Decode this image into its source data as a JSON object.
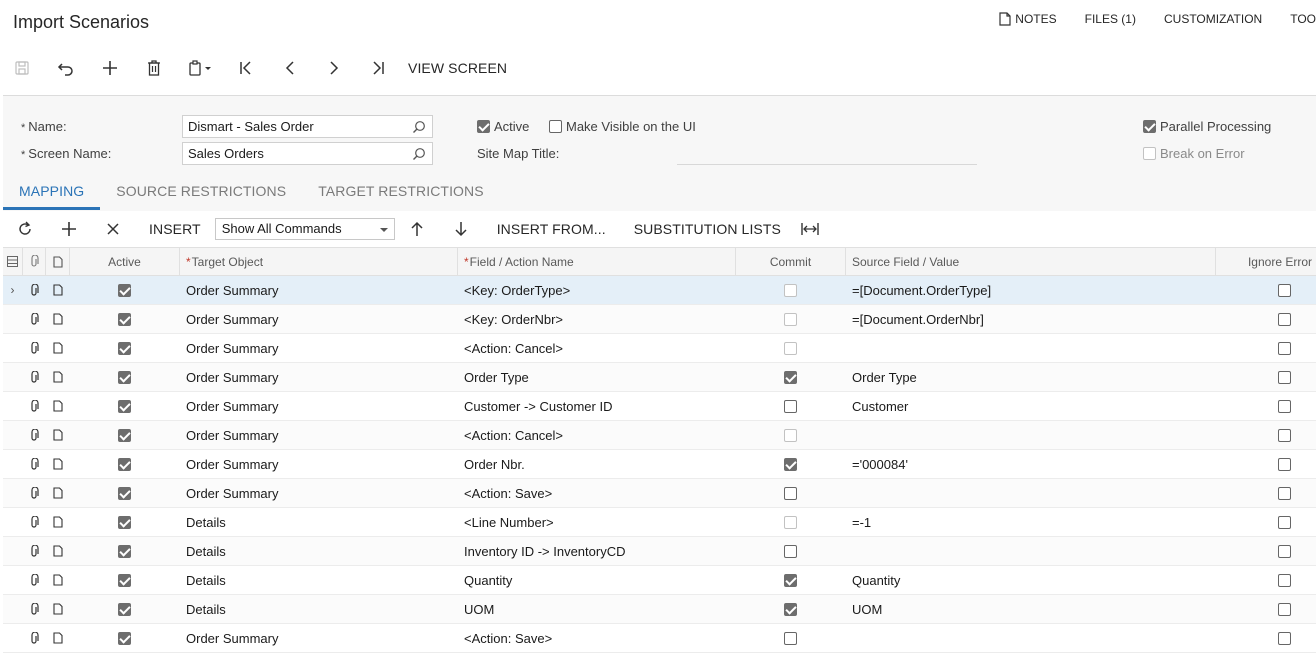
{
  "header": {
    "title": "Import Scenarios",
    "links": [
      {
        "label": "NOTES",
        "icon": "note-icon"
      },
      {
        "label": "FILES (1)"
      },
      {
        "label": "CUSTOMIZATION"
      },
      {
        "label": "TOO"
      }
    ]
  },
  "toolbar": {
    "view_screen": "VIEW SCREEN"
  },
  "form": {
    "name_label": "Name:",
    "name_value": "Dismart - Sales Order",
    "screen_name_label": "Screen Name:",
    "screen_name_value": "Sales Orders",
    "active_label": "Active",
    "active_checked": true,
    "make_visible_label": "Make Visible on the UI",
    "make_visible_checked": false,
    "site_map_title_label": "Site Map Title:",
    "parallel_processing_label": "Parallel Processing",
    "parallel_processing_checked": true,
    "break_on_error_label": "Break on Error",
    "break_on_error_checked": false
  },
  "tabs": [
    {
      "label": "MAPPING",
      "active": true
    },
    {
      "label": "SOURCE RESTRICTIONS",
      "active": false
    },
    {
      "label": "TARGET RESTRICTIONS",
      "active": false
    }
  ],
  "grid_toolbar": {
    "insert": "INSERT",
    "command_filter": "Show All Commands",
    "insert_from": "INSERT FROM...",
    "substitution_lists": "SUBSTITUTION LISTS"
  },
  "grid": {
    "columns": {
      "active": "Active",
      "target": "Target Object",
      "field": "Field / Action Name",
      "commit": "Commit",
      "source": "Source Field / Value",
      "ignore": "Ignore Error"
    },
    "rows": [
      {
        "active": true,
        "target": "Order Summary",
        "field": "<Key: OrderType>",
        "commit": false,
        "commit_disabled": true,
        "source": "=[Document.OrderType]",
        "ignore": false
      },
      {
        "active": true,
        "target": "Order Summary",
        "field": "<Key: OrderNbr>",
        "commit": false,
        "commit_disabled": true,
        "source": "=[Document.OrderNbr]",
        "ignore": false
      },
      {
        "active": true,
        "target": "Order Summary",
        "field": "<Action: Cancel>",
        "commit": false,
        "commit_disabled": true,
        "source": "",
        "ignore": false
      },
      {
        "active": true,
        "target": "Order Summary",
        "field": "Order Type",
        "commit": true,
        "commit_disabled": false,
        "source": "Order Type",
        "ignore": false
      },
      {
        "active": true,
        "target": "Order Summary",
        "field": "Customer -> Customer ID",
        "commit": false,
        "commit_disabled": false,
        "source": "Customer",
        "ignore": false
      },
      {
        "active": true,
        "target": "Order Summary",
        "field": "<Action: Cancel>",
        "commit": false,
        "commit_disabled": true,
        "source": "",
        "ignore": false
      },
      {
        "active": true,
        "target": "Order Summary",
        "field": "Order Nbr.",
        "commit": true,
        "commit_disabled": false,
        "source": "='000084'",
        "ignore": false
      },
      {
        "active": true,
        "target": "Order Summary",
        "field": "<Action: Save>",
        "commit": false,
        "commit_disabled": false,
        "source": "",
        "ignore": false
      },
      {
        "active": true,
        "target": "Details",
        "field": "<Line Number>",
        "commit": false,
        "commit_disabled": true,
        "source": "=-1",
        "ignore": false
      },
      {
        "active": true,
        "target": "Details",
        "field": "Inventory ID -> InventoryCD",
        "commit": false,
        "commit_disabled": false,
        "source": "",
        "ignore": false
      },
      {
        "active": true,
        "target": "Details",
        "field": "Quantity",
        "commit": true,
        "commit_disabled": false,
        "source": "Quantity",
        "ignore": false
      },
      {
        "active": true,
        "target": "Details",
        "field": "UOM",
        "commit": true,
        "commit_disabled": false,
        "source": "UOM",
        "ignore": false
      },
      {
        "active": true,
        "target": "Order Summary",
        "field": "<Action: Save>",
        "commit": false,
        "commit_disabled": false,
        "source": "",
        "ignore": false
      }
    ]
  }
}
